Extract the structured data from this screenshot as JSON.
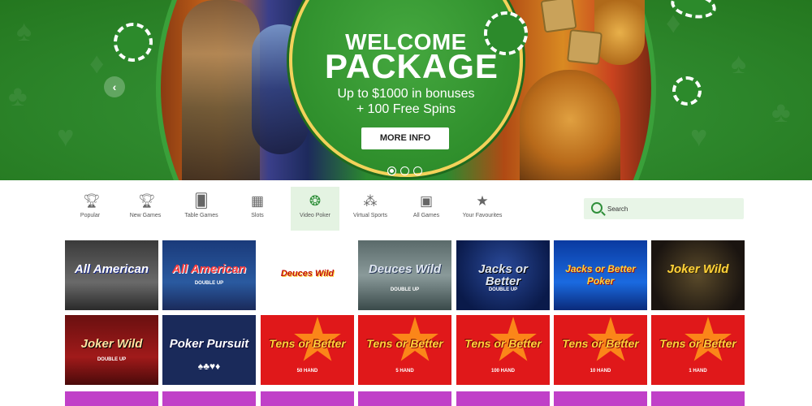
{
  "hero": {
    "title_line1": "WELCOME",
    "title_line2": "PACKAGE",
    "subtitle_line1": "Up to $1000 in bonuses",
    "subtitle_line2": "+ 100 Free Spins",
    "button_label": "MORE INFO",
    "slides_total": 3,
    "active_slide": 1
  },
  "categories": [
    {
      "label": "Popular",
      "icon": "trophy-icon"
    },
    {
      "label": "New Games",
      "icon": "trophy-icon"
    },
    {
      "label": "Table Games",
      "icon": "cards-icon"
    },
    {
      "label": "Slots",
      "icon": "slot-machine-icon"
    },
    {
      "label": "Video Poker",
      "icon": "poker-chip-icon",
      "active": true
    },
    {
      "label": "Virtual Sports",
      "icon": "virtual-sports-icon"
    },
    {
      "label": "All Games",
      "icon": "grid-icon"
    },
    {
      "label": "Your Favourites",
      "icon": "bookmark-star-icon"
    }
  ],
  "search": {
    "placeholder": "Search"
  },
  "games_row1": [
    {
      "name": "All American",
      "sub": ""
    },
    {
      "name": "All American",
      "sub": "DOUBLE UP"
    },
    {
      "name": "Deuces Wild",
      "sub": ""
    },
    {
      "name": "Deuces Wild",
      "sub": "DOUBLE UP"
    },
    {
      "name": "Jacks or Better",
      "sub": "DOUBLE UP"
    },
    {
      "name": "Jacks or Better Poker",
      "sub": ""
    },
    {
      "name": "Joker Wild",
      "sub": ""
    }
  ],
  "games_row2": [
    {
      "name": "Joker Wild",
      "sub": "DOUBLE UP"
    },
    {
      "name": "Poker Pursuit",
      "sub": ""
    },
    {
      "name": "Tens or Better",
      "sub": "50 HAND"
    },
    {
      "name": "Tens or Better",
      "sub": "5 HAND"
    },
    {
      "name": "Tens or Better",
      "sub": "100 HAND"
    },
    {
      "name": "Tens or Better",
      "sub": "10 HAND"
    },
    {
      "name": "Tens or Better",
      "sub": "1 HAND"
    }
  ],
  "colors": {
    "brand_green": "#2f8a2e",
    "accent_gold": "#f3d25a",
    "active_tab_bg": "#e4f3e2",
    "search_bg": "#e8f5e7"
  }
}
